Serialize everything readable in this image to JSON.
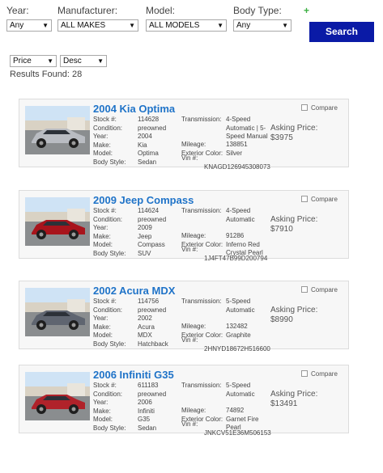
{
  "filters": {
    "year_label": "Year:",
    "manufacturer_label": "Manufacturer:",
    "model_label": "Model:",
    "body_type_label": "Body Type:",
    "year_value": "Any",
    "manufacturer_value": "ALL MAKES",
    "model_value": "ALL MODELS",
    "body_type_value": "Any",
    "plus": "+",
    "search_label": "Search"
  },
  "sort": {
    "field_value": "Price",
    "order_value": "Desc"
  },
  "results_label": "Results Found: 28",
  "field_labels": {
    "stock": "Stock #:",
    "condition": "Condition:",
    "year": "Year:",
    "make": "Make:",
    "model": "Model:",
    "body_style": "Body Style:",
    "transmission": "Transmission:",
    "mileage": "Mileage:",
    "exterior_color": "Exterior Color:",
    "vin": "Vin #:",
    "compare": "Compare",
    "asking_price": "Asking Price:"
  },
  "listings": [
    {
      "title": "2004 Kia Optima",
      "stock": "114628",
      "condition": "preowned",
      "year": "2004",
      "make": "Kia",
      "model": "Optima",
      "body_style": "Sedan",
      "transmission": "4-Speed Automatic | 5-Speed Manual",
      "mileage": "138851",
      "exterior_color": "Silver",
      "vin": "KNAGD126945308073",
      "price": "$3975",
      "car_color": "#b9bcc2"
    },
    {
      "title": "2009 Jeep Compass",
      "stock": "114624",
      "condition": "preowned",
      "year": "2009",
      "make": "Jeep",
      "model": "Compass",
      "body_style": "SUV",
      "transmission": "4-Speed Automatic",
      "mileage": "91286",
      "exterior_color": "Inferno Red Crystal Pearl",
      "vin": "1J4FT47B99D200794",
      "price": "$7910",
      "car_color": "#a8141c"
    },
    {
      "title": "2002 Acura MDX",
      "stock": "114756",
      "condition": "preowned",
      "year": "2002",
      "make": "Acura",
      "model": "MDX",
      "body_style": "Hatchback",
      "transmission": "5-Speed Automatic",
      "mileage": "132482",
      "exterior_color": "Graphite",
      "vin": "2HNYD18672H516600",
      "price": "$8990",
      "car_color": "#5f6570"
    },
    {
      "title": "2006 Infiniti G35",
      "stock": "611183",
      "condition": "preowned",
      "year": "2006",
      "make": "Infiniti",
      "model": "G35",
      "body_style": "Sedan",
      "transmission": "5-Speed Automatic",
      "mileage": "74892",
      "exterior_color": "Garnet Fire Pearl",
      "vin": "JNKCV51E36M506153",
      "price": "$13491",
      "car_color": "#b0222a"
    }
  ]
}
